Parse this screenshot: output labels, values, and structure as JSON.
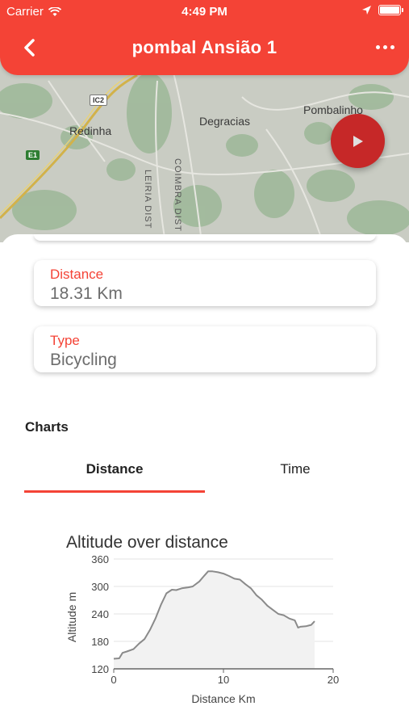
{
  "status_bar": {
    "carrier": "Carrier",
    "time": "4:49 PM"
  },
  "header": {
    "title": "pombal Ansião 1",
    "back_icon": "chevron-left-icon",
    "more_icon": "more-horizontal-icon"
  },
  "map": {
    "labels": {
      "redinha": "Redinha",
      "degracias": "Degracias",
      "pombalinho": "Pombalinho"
    },
    "road_labels": {
      "leiria": "LEIRIA DIST",
      "coimbra": "COIMBRA DIST"
    },
    "shields": {
      "ic2": "IC2",
      "e1": "E1"
    }
  },
  "fab": {
    "icon": "play-icon"
  },
  "details": {
    "distance": {
      "label": "Distance",
      "value": "18.31 Km"
    },
    "type": {
      "label": "Type",
      "value": "Bicycling"
    }
  },
  "charts_section": {
    "title": "Charts"
  },
  "tabs": [
    {
      "label": "Distance",
      "active": true
    },
    {
      "label": "Time",
      "active": false
    }
  ],
  "colors": {
    "accent": "#f44336",
    "fab": "#c62828",
    "line": "#8a8a8a"
  },
  "chart_data": {
    "type": "area",
    "title": "Altitude over distance",
    "xlabel": "Distance Km",
    "ylabel": "Altitude m",
    "xlim": [
      0,
      20
    ],
    "ylim": [
      120,
      360
    ],
    "xticks": [
      "0",
      "10",
      "20"
    ],
    "yticks": [
      "120",
      "180",
      "240",
      "300",
      "360"
    ],
    "grid": true,
    "series": [
      {
        "x": [
          0,
          0.5,
          0.8,
          1.2,
          1.8,
          2.3,
          2.8,
          3.3,
          3.8,
          4.3,
          4.8,
          5.3,
          5.7,
          6.2,
          6.8,
          7.2,
          7.8,
          8.2,
          8.6,
          9.0,
          9.5,
          10.0,
          10.5,
          11.0,
          11.5,
          12.0,
          12.5,
          13.0,
          13.5,
          14.0,
          14.5,
          15.0,
          15.5,
          16.0,
          16.5,
          16.8,
          17.0,
          17.5,
          18.0,
          18.31
        ],
        "y": [
          142,
          143,
          155,
          158,
          163,
          175,
          185,
          205,
          230,
          260,
          285,
          293,
          292,
          296,
          298,
          300,
          311,
          322,
          333,
          333,
          331,
          328,
          323,
          317,
          315,
          305,
          296,
          281,
          271,
          258,
          249,
          240,
          237,
          230,
          226,
          210,
          212,
          213,
          216,
          224
        ]
      }
    ]
  }
}
